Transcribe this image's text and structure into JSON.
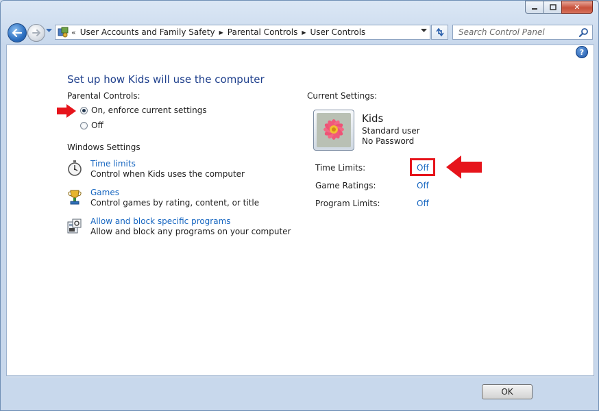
{
  "window": {
    "caption_buttons": {
      "minimize_icon": "minimize-icon",
      "maximize_icon": "maximize-icon",
      "close_glyph": "✕"
    }
  },
  "navigation": {
    "back_icon": "back-arrow-icon",
    "forward_icon": "forward-arrow-icon",
    "address": {
      "breadcrumbs": [
        "User Accounts and Family Safety",
        "Parental Controls",
        "User Controls"
      ],
      "overflow_glyph": "«"
    },
    "search": {
      "placeholder": "Search Control Panel"
    }
  },
  "main": {
    "heading": "Set up how Kids will use the computer",
    "parental_controls": {
      "label": "Parental Controls:",
      "options": [
        {
          "label": "On, enforce current settings",
          "selected": true
        },
        {
          "label": "Off",
          "selected": false
        }
      ]
    },
    "windows_settings": {
      "label": "Windows Settings",
      "items": [
        {
          "link": "Time limits",
          "description": "Control when Kids uses the computer",
          "icon": "stopwatch-icon"
        },
        {
          "link": "Games",
          "description": "Control games by rating, content, or title",
          "icon": "games-trophy-icon"
        },
        {
          "link": "Allow and block specific programs",
          "description": "Allow and block any programs on your computer",
          "icon": "program-block-icon"
        }
      ]
    },
    "current_settings": {
      "label": "Current Settings:",
      "user": {
        "name": "Kids",
        "type": "Standard user",
        "password": "No Password"
      },
      "rows": [
        {
          "label": "Time Limits:",
          "value": "Off"
        },
        {
          "label": "Game Ratings:",
          "value": "Off"
        },
        {
          "label": "Program Limits:",
          "value": "Off"
        }
      ]
    }
  },
  "annotations": {
    "arrow_color": "#e6141b"
  },
  "footer": {
    "ok_label": "OK"
  },
  "colors": {
    "link": "#1565c0",
    "heading": "#1e3f8c",
    "highlight": "#e6141b"
  }
}
